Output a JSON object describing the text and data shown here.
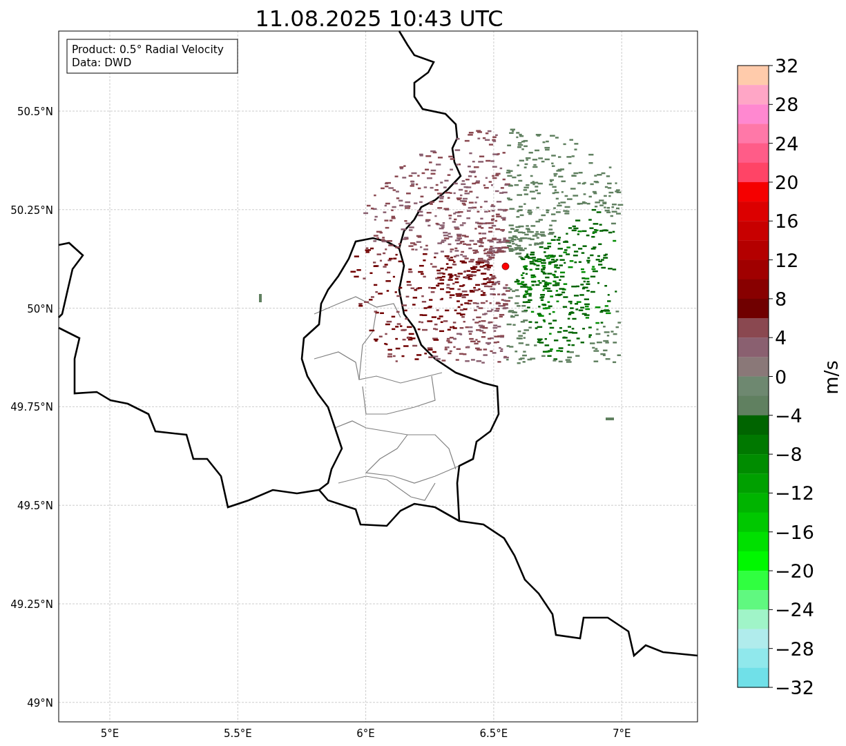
{
  "title": "11.08.2025 10:43 UTC",
  "info_box": {
    "lines": [
      "Product: 0.5° Radial Velocity",
      "Data: DWD"
    ]
  },
  "map": {
    "lat_labels": [
      "50.5°N",
      "50.25°N",
      "50°N",
      "49.75°N",
      "49.5°N",
      "49.25°N",
      "49°N"
    ],
    "lon_labels": [
      "5°E",
      "5.5°E",
      "6°E",
      "6.5°E",
      "7°E"
    ],
    "radar_site": {
      "color": "#ff0000"
    }
  },
  "colorbar": {
    "label": "m/s",
    "ticks": [
      "32",
      "28",
      "24",
      "20",
      "16",
      "12",
      "8",
      "4",
      "0",
      "−4",
      "−8",
      "−12",
      "−16",
      "−20",
      "−24",
      "−28",
      "−32"
    ],
    "bands": [
      {
        "color": "#ffcbab"
      },
      {
        "color": "#ffa6c6"
      },
      {
        "color": "#ff88d0"
      },
      {
        "color": "#ff78a8"
      },
      {
        "color": "#ff5c88"
      },
      {
        "color": "#ff4466"
      },
      {
        "color": "#f50000"
      },
      {
        "color": "#dc0000"
      },
      {
        "color": "#c80000"
      },
      {
        "color": "#b40000"
      },
      {
        "color": "#a00000"
      },
      {
        "color": "#880000"
      },
      {
        "color": "#700000"
      },
      {
        "color": "#8a4850"
      },
      {
        "color": "#8a6070"
      },
      {
        "color": "#8a7878"
      },
      {
        "color": "#6e8870"
      },
      {
        "color": "#608060"
      },
      {
        "color": "#006400"
      },
      {
        "color": "#007800"
      },
      {
        "color": "#008c00"
      },
      {
        "color": "#00a000"
      },
      {
        "color": "#00b400"
      },
      {
        "color": "#00c800"
      },
      {
        "color": "#00e000"
      },
      {
        "color": "#00f800"
      },
      {
        "color": "#30ff40"
      },
      {
        "color": "#60f880"
      },
      {
        "color": "#a0f4c8"
      },
      {
        "color": "#b0ecec"
      },
      {
        "color": "#90e8ec"
      },
      {
        "color": "#70e0e8"
      }
    ]
  }
}
